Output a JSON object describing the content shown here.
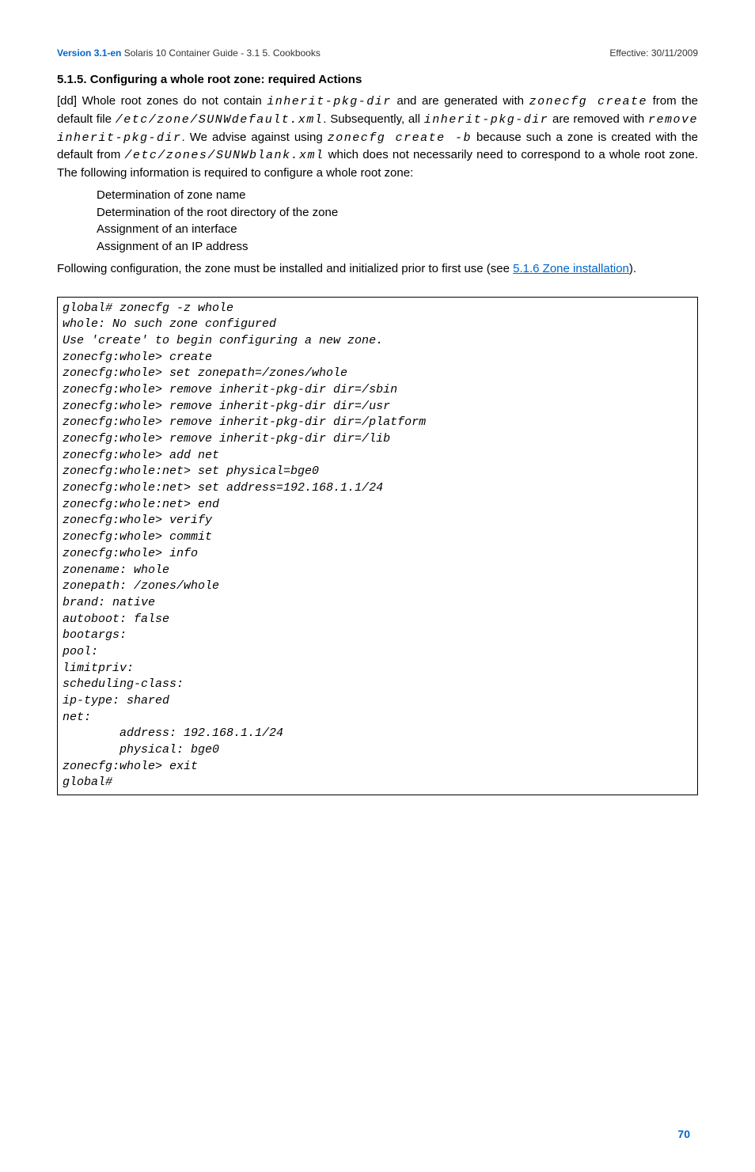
{
  "header": {
    "version": "Version 3.1-en",
    "title_gray": "Solaris 10 Container Guide - 3.1  5. Cookbooks",
    "effective": "Effective: 30/11/2009"
  },
  "section": {
    "heading": "5.1.5. Configuring a whole root zone: required Actions",
    "p1_a": "[dd] Whole root zones do not contain ",
    "p1_code1": "inherit-pkg-dir",
    "p1_b": " and are generated with ",
    "p1_code2": "zonecfg create",
    "p1_c": " from the default file ",
    "p1_code3": "/etc/zone/SUNWdefault.xml",
    "p1_d": ". Subsequently, all ",
    "p1_code4": "inherit-pkg-dir",
    "p1_e": " are removed with ",
    "p1_code5": "remove inherit-pkg-dir",
    "p1_f": ". We advise against using ",
    "p1_code6": "zonecfg create -b",
    "p1_g": " because such a zone is created with the default from ",
    "p1_code7": "/etc/zones/SUNWblank.xml",
    "p1_h": " which does not necessarily need to correspond to a whole root zone. The following information is required to configure a whole root zone:",
    "bullets": [
      "Determination of zone name",
      "Determination of the root directory of the zone",
      "Assignment of an interface",
      "Assignment of an IP address"
    ],
    "p2_a": "Following configuration, the zone must be installed and initialized prior to first use (see ",
    "p2_link": "5.1.6 Zone installation",
    "p2_b": ")."
  },
  "code": "global# zonecfg -z whole\nwhole: No such zone configured\nUse 'create' to begin configuring a new zone.\nzonecfg:whole> create\nzonecfg:whole> set zonepath=/zones/whole\nzonecfg:whole> remove inherit-pkg-dir dir=/sbin\nzonecfg:whole> remove inherit-pkg-dir dir=/usr\nzonecfg:whole> remove inherit-pkg-dir dir=/platform\nzonecfg:whole> remove inherit-pkg-dir dir=/lib\nzonecfg:whole> add net\nzonecfg:whole:net> set physical=bge0\nzonecfg:whole:net> set address=192.168.1.1/24\nzonecfg:whole:net> end\nzonecfg:whole> verify\nzonecfg:whole> commit\nzonecfg:whole> info\nzonename: whole\nzonepath: /zones/whole\nbrand: native\nautoboot: false\nbootargs:\npool:\nlimitpriv:\nscheduling-class:\nip-type: shared\nnet:\n        address: 192.168.1.1/24\n        physical: bge0\nzonecfg:whole> exit\nglobal#",
  "page_number": "70"
}
